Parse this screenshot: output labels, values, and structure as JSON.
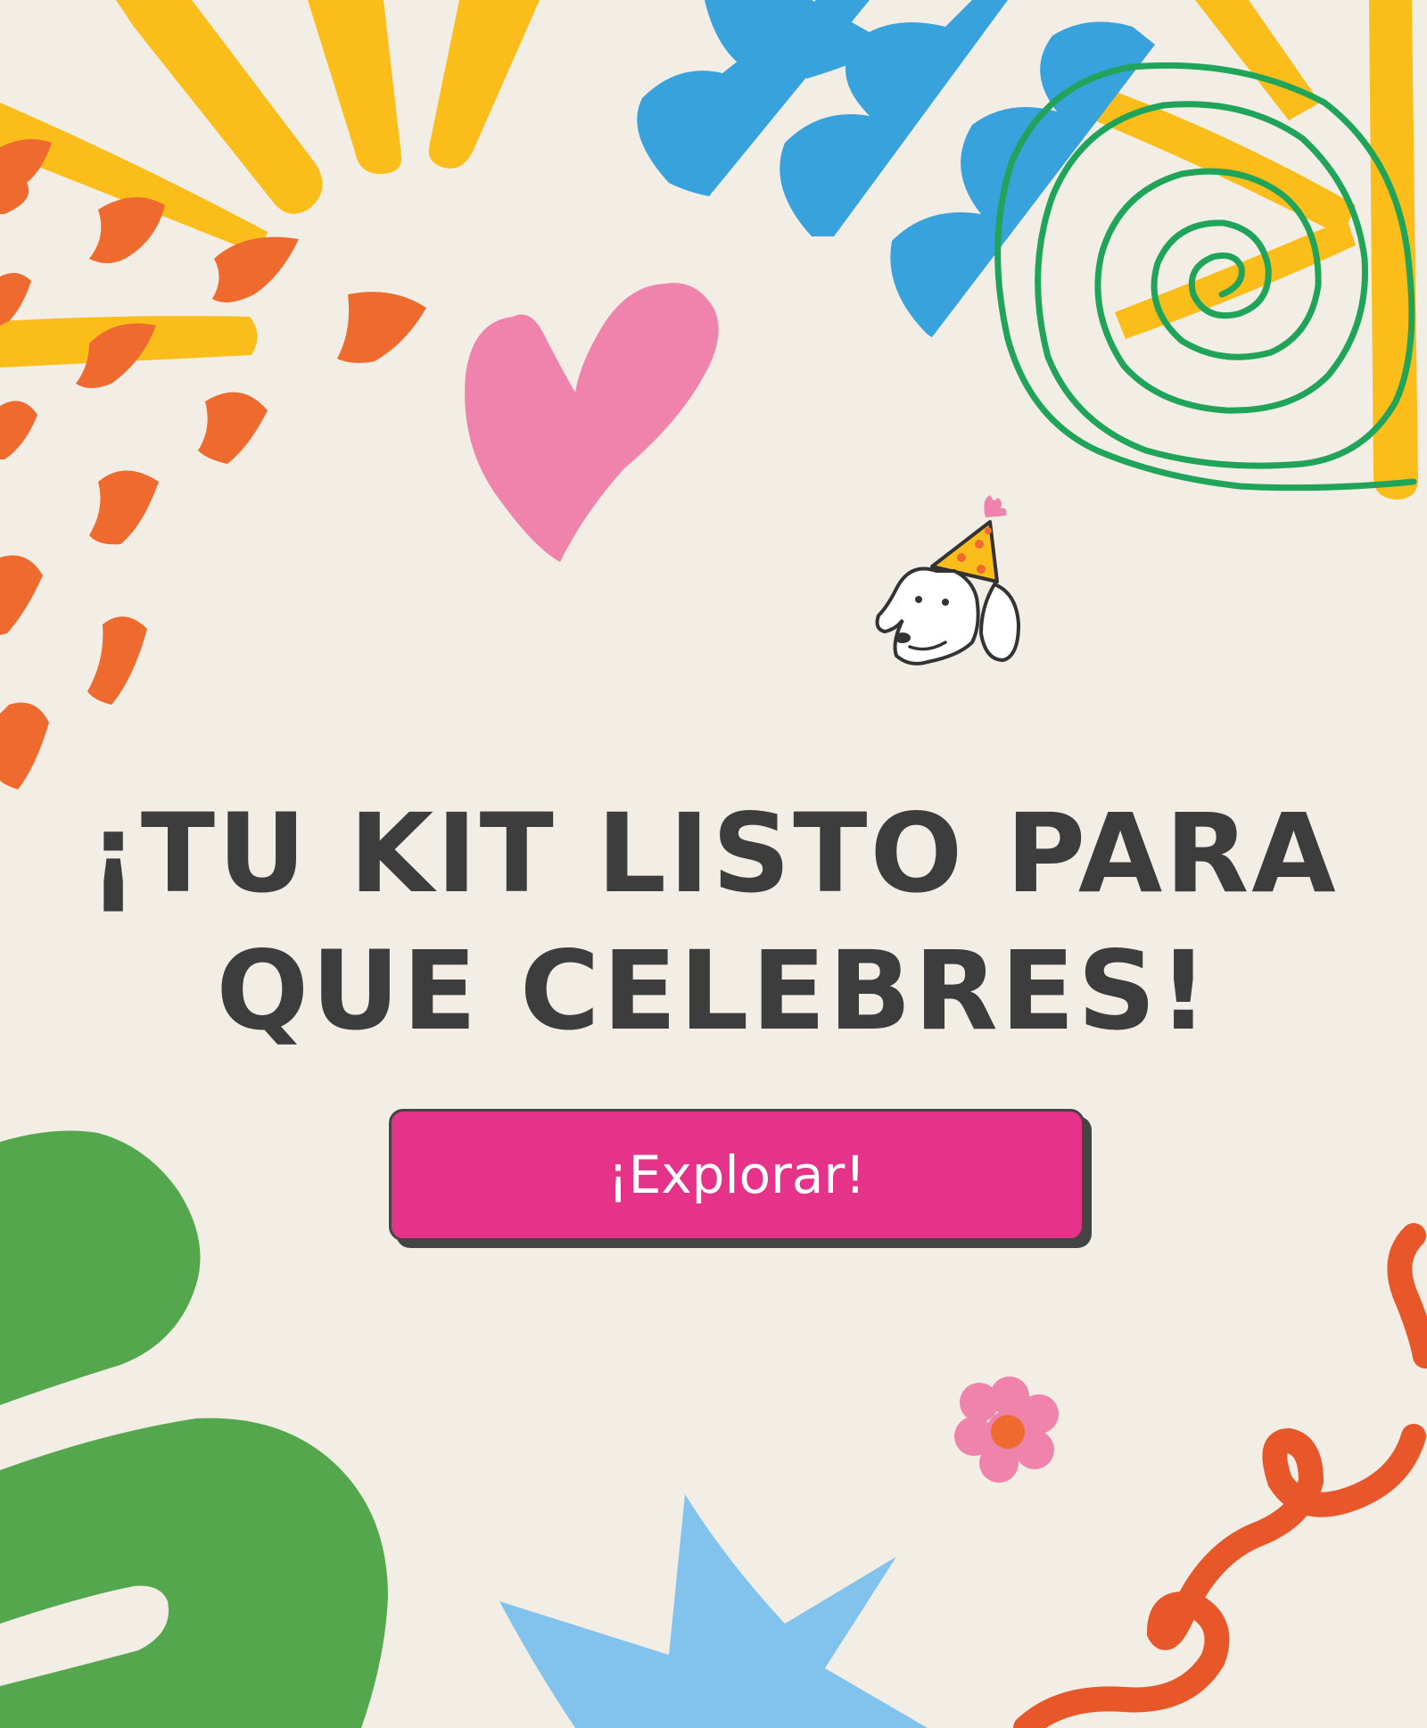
{
  "headline": {
    "line1": "¡TU KIT LISTO PARA",
    "line2": "QUE CELEBRES!"
  },
  "cta": {
    "label": "¡Explorar!"
  },
  "colors": {
    "background": "#f2eee6",
    "text": "#3d3d3d",
    "button": "#e5338a",
    "button_shadow": "#444444",
    "sun_yellow": "#fbbd1a",
    "confetti_orange": "#ee6a2e",
    "cloud_blue": "#37a2dc",
    "spiral_green": "#1fa45a",
    "heart_pink": "#ef83ac",
    "blob_green": "#54a74c",
    "star_blue": "#82c3ee",
    "swirl_orange": "#e8572a",
    "flower_pink": "#ef83ac"
  },
  "icons": [
    "sun-rays-icon",
    "confetti-icon",
    "cloud-icon",
    "spiral-icon",
    "heart-icon",
    "party-dog-icon",
    "flower-icon",
    "star-icon",
    "blob-icon",
    "swirl-icon"
  ]
}
